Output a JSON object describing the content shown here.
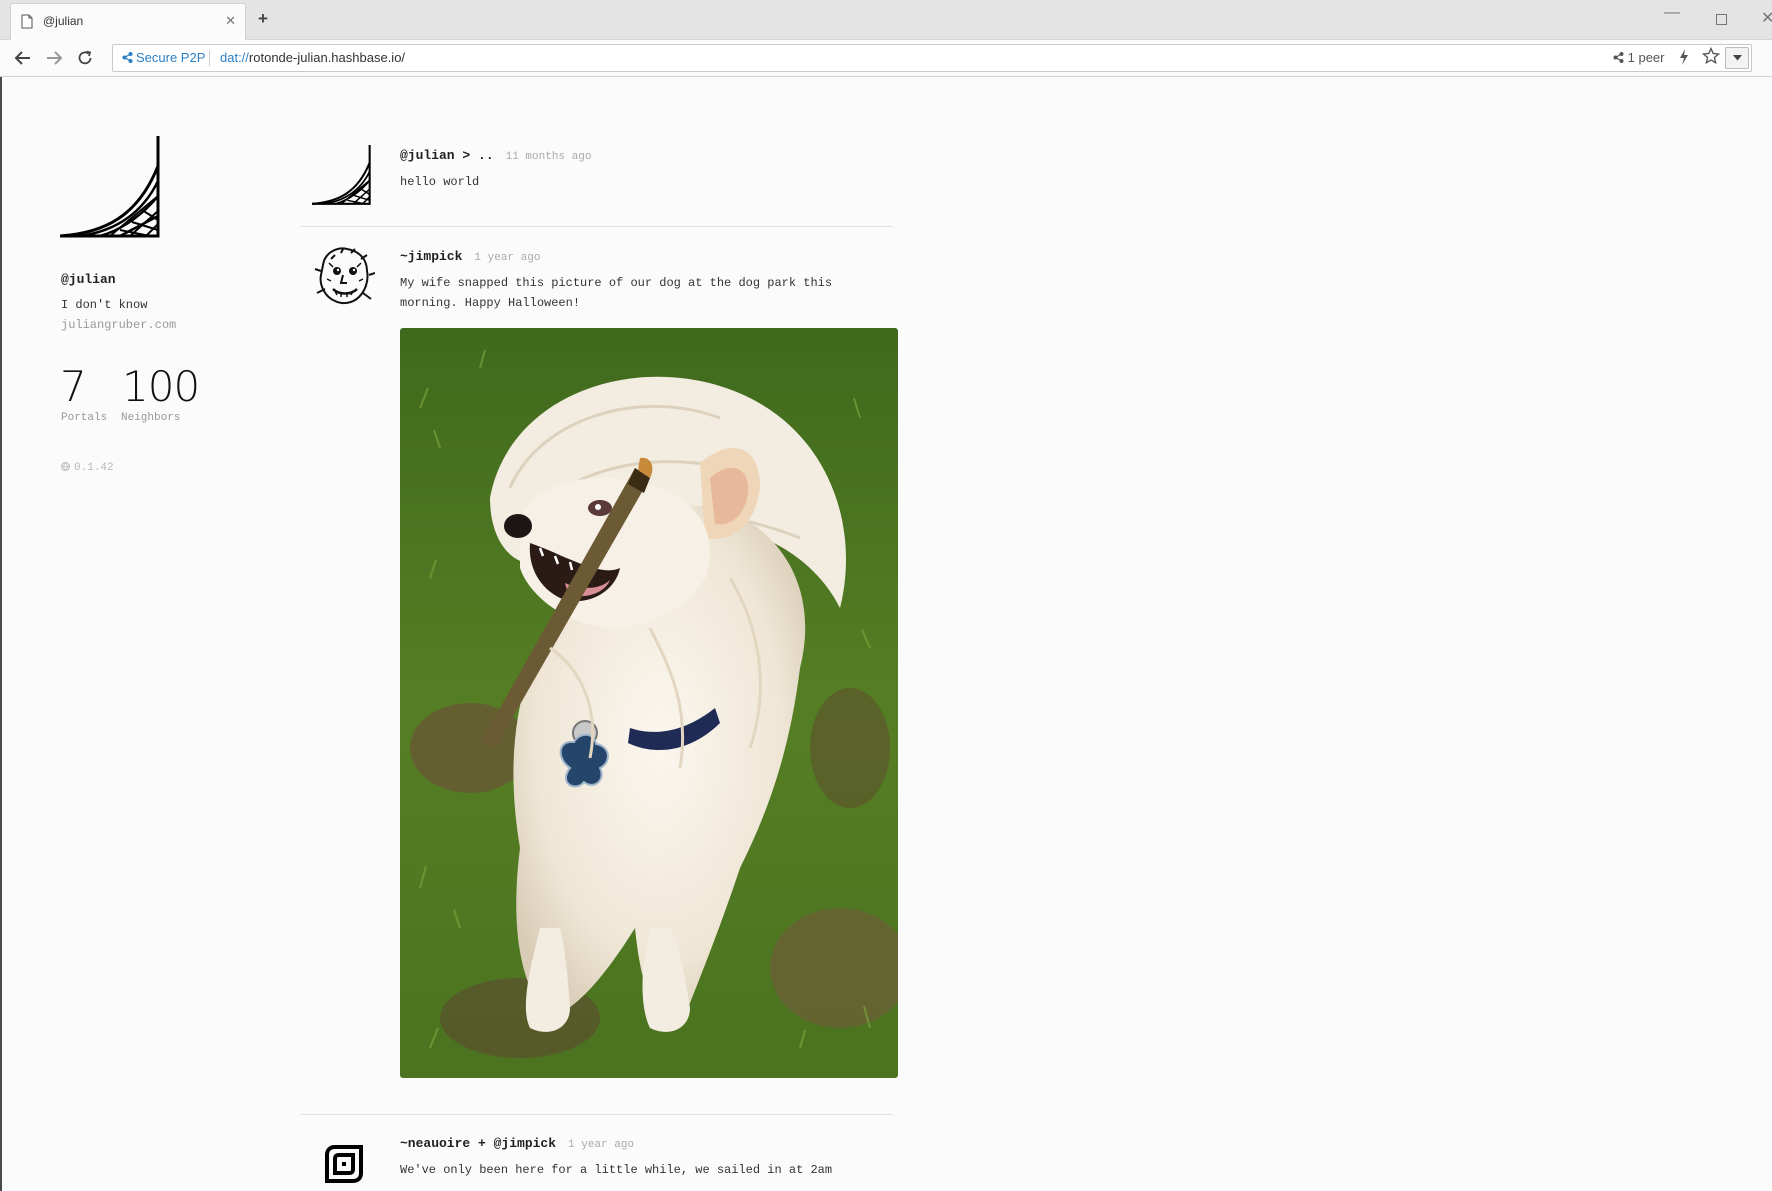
{
  "browser": {
    "tab_title": "@julian",
    "new_tab": "+",
    "secure_label": "Secure P2P",
    "url_scheme": "dat://",
    "url_rest": "rotonde-julian.hashbase.io/",
    "peers": "1 peer"
  },
  "profile": {
    "name": "@julian",
    "bio": "I don't know",
    "site": "juliangruber.com",
    "portals_count": "7",
    "portals_label": "Portals",
    "neighbors_count": "100",
    "neighbors_label": "Neighbors",
    "version": "0.1.42"
  },
  "feed": [
    {
      "author": "@julian > ..",
      "time": "11 months ago",
      "text": "hello world"
    },
    {
      "author": "~jimpick",
      "time": "1 year ago",
      "text": "My wife snapped this picture of our dog at the dog park this\nmorning. Happy Halloween!"
    },
    {
      "author": "~neauoire + @jimpick",
      "time": "1 year ago",
      "text": "We've only been here for a little while, we sailed in at 2am"
    }
  ]
}
